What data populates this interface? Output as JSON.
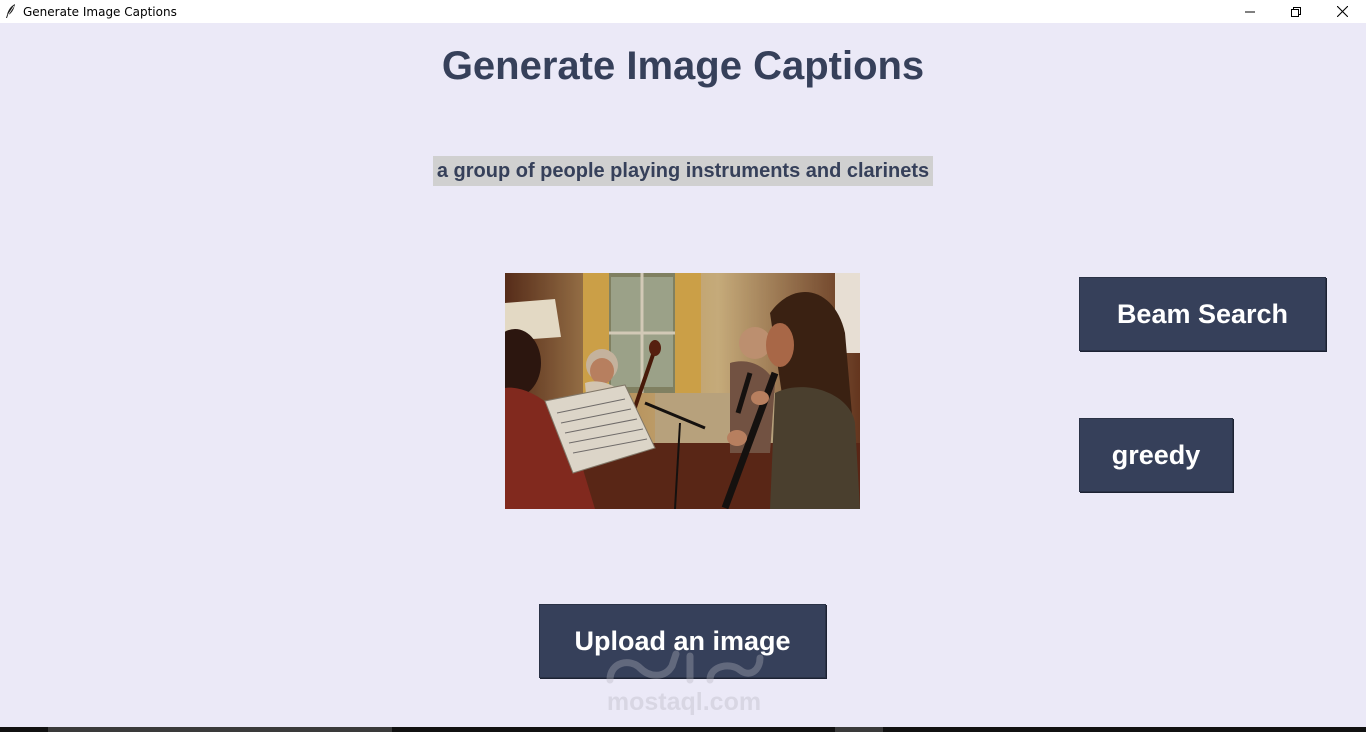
{
  "window": {
    "title": "Generate Image Captions",
    "icon": "feather-icon",
    "controls": [
      "minimize-icon",
      "restore-icon",
      "close-icon"
    ]
  },
  "main": {
    "heading": "Generate Image Captions",
    "caption": "a group of people playing instruments and clarinets",
    "image_alt": "photo of people playing music"
  },
  "buttons": {
    "beam_search": "Beam Search",
    "greedy": "greedy",
    "upload": "Upload an image"
  },
  "watermark": {
    "text": "mostaql.com"
  },
  "colors": {
    "background": "#ebe9f7",
    "accent": "#36405a",
    "caption_bg": "#d0d0d0",
    "button_text": "#ffffff"
  }
}
